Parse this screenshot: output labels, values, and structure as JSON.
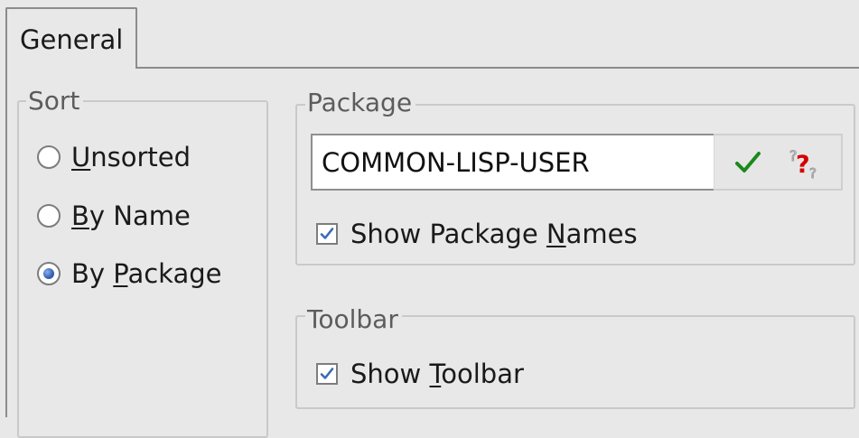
{
  "tabs": [
    {
      "label": "General",
      "active": true
    }
  ],
  "sort": {
    "title": "Sort",
    "options": [
      {
        "before": "",
        "mnemonic": "U",
        "after": "nsorted",
        "checked": false
      },
      {
        "before": "",
        "mnemonic": "B",
        "after": "y Name",
        "checked": false
      },
      {
        "before": "By ",
        "mnemonic": "P",
        "after": "ackage",
        "checked": true
      }
    ]
  },
  "package": {
    "title": "Package",
    "input_value": "COMMON-LISP-USER",
    "confirm_icon": "checkmark-icon",
    "help_icon": "help-question-icon",
    "show_names": {
      "before": "Show Package ",
      "mnemonic": "N",
      "after": "ames",
      "checked": true
    }
  },
  "toolbar": {
    "title": "Toolbar",
    "show_toolbar": {
      "before": "Show ",
      "mnemonic": "T",
      "after": "oolbar",
      "checked": true
    }
  },
  "colors": {
    "background": "#e8e8e8",
    "check_green": "#1a8a1a",
    "help_red": "#d40000",
    "radio_blue": "#3a66b8",
    "checkbox_blue": "#3d6ab5"
  }
}
